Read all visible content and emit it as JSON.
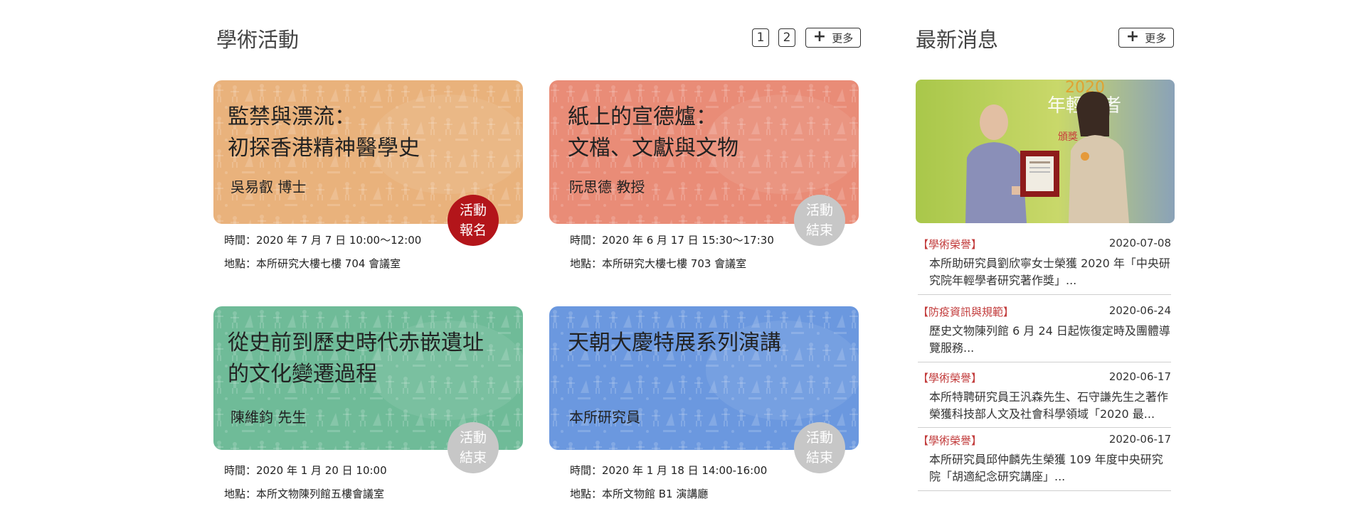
{
  "events": {
    "title": "學術活動",
    "pages": [
      "1",
      "2"
    ],
    "more_label": "更多",
    "items": [
      {
        "title": "監禁與漂流：\n初探香港精神醫學史",
        "speaker": "吳易叡 博士",
        "badge": "活動\n報名",
        "status": "open",
        "time": "時間：2020 年 7 月 7 日 10:00～12:00",
        "place": "地點：本所研究大樓七樓 704 會議室",
        "color": "#e9b27c"
      },
      {
        "title": "紙上的宣德爐：\n文檔、文獻與文物",
        "speaker": "阮思德 教授",
        "badge": "活動\n結束",
        "status": "closed",
        "time": "時間：2020 年 6 月 17 日 15:30～17:30",
        "place": "地點：本所研究大樓七樓 703 會議室",
        "color": "#e98c77"
      },
      {
        "title": "從史前到歷史時代赤嵌遺址\n的文化變遷過程",
        "speaker": "陳維鈞 先生",
        "badge": "活動\n結束",
        "status": "closed",
        "time": "時間：2020 年 1 月 20 日 10:00",
        "place": "地點：本所文物陳列館五樓會議室",
        "color": "#6fbb98"
      },
      {
        "title": "天朝大慶特展系列演講",
        "speaker": "本所研究員",
        "badge": "活動\n結束",
        "status": "closed",
        "time": "時間：2020 年 1 月 18 日 14:00-16:00",
        "place": "地點：本所文物館 B1 演講廳",
        "color": "#6b98df"
      }
    ]
  },
  "news": {
    "title": "最新消息",
    "more_label": "更多",
    "photo_text": {
      "year": "2020",
      "caption": "年輕學者",
      "plaque_caption": "頒獎"
    },
    "items": [
      {
        "category": "【學術榮譽】",
        "date": "2020-07-08",
        "text": "本所助研究員劉欣寧女士榮獲 2020 年「中央研究院年輕學者研究著作獎」..."
      },
      {
        "category": "【防疫資訊與規範】",
        "date": "2020-06-24",
        "text": "歷史文物陳列館 6 月 24 日起恢復定時及團體導覽服務..."
      },
      {
        "category": "【學術榮譽】",
        "date": "2020-06-17",
        "text": "本所特聘研究員王汎森先生、石守謙先生之著作榮獲科技部人文及社會科學領域「2020 最..."
      },
      {
        "category": "【學術榮譽】",
        "date": "2020-06-17",
        "text": "本所研究員邱仲麟先生榮獲 109 年度中央研究院「胡適紀念研究講座」..."
      }
    ]
  }
}
